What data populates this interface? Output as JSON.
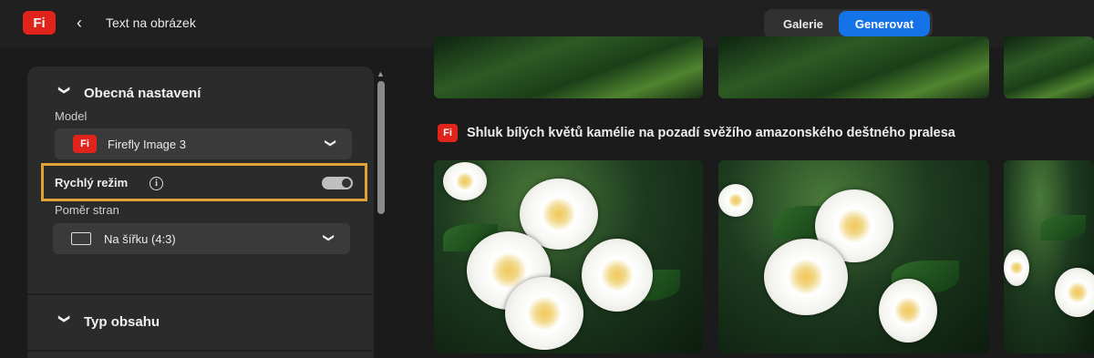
{
  "app": {
    "logo": "Fi",
    "back_icon": "chevron-left-icon",
    "title": "Text na obrázek"
  },
  "view_switch": {
    "gallery": "Galerie",
    "generate": "Generovat",
    "selected": "Generovat"
  },
  "settings": {
    "general": {
      "title": "Obecná nastavení",
      "expanded": true
    },
    "model": {
      "label": "Model",
      "value": "Firefly Image 3",
      "logo": "Fi"
    },
    "fast_mode": {
      "label": "Rychlý režim",
      "enabled": true,
      "highlight_color": "#e0a436"
    },
    "aspect": {
      "label": "Poměr stran",
      "value": "Na šířku (4:3)"
    },
    "content_type": {
      "title": "Typ obsahu"
    }
  },
  "results": {
    "prompt_logo": "Fi",
    "prompt": "Shluk bílých květů kamélie na pozadí svěžího amazonského deštného pralesa"
  },
  "colors": {
    "accent": "#1473e6",
    "brand": "#e0241b",
    "background": "#1b1b1b",
    "panel": "#2b2b2b"
  }
}
